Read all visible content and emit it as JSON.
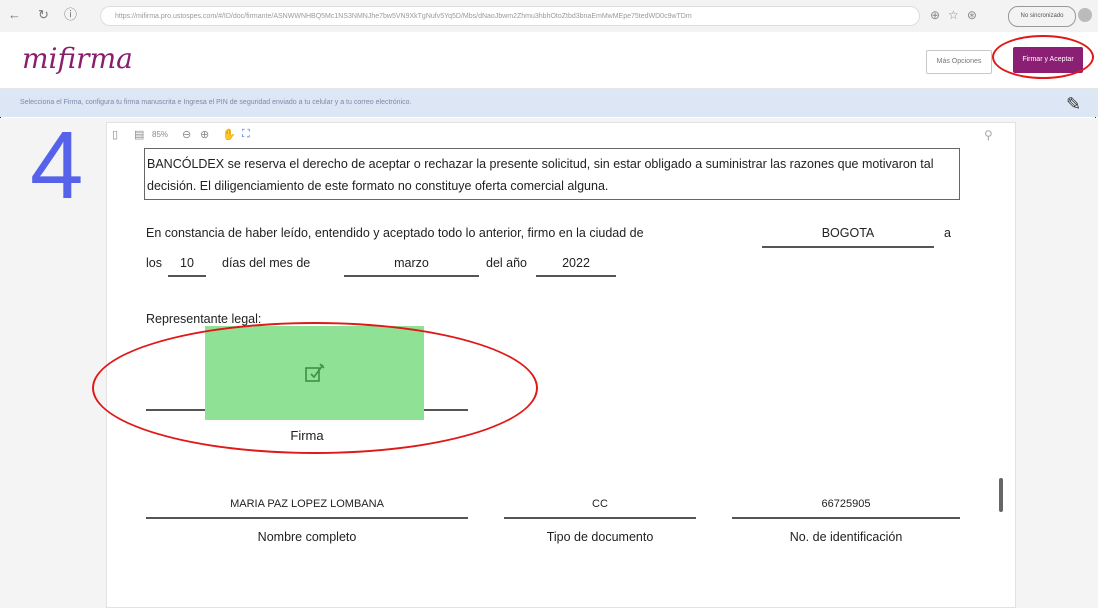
{
  "browser": {
    "url": "https://mifirma.pro.ustospes.com/#/ID/doc/firmante/ASNWWNHBQ5Mc1NS3NMNJhe7bw5VN9XkTgNufv5Yq5D/Mbs/dNaoJbwm2Zhmu3hbhOtoZtbd3bnaEmMwMEpe75tedWD0c9wTDm",
    "profile_label": "No sincronizado"
  },
  "header": {
    "logo": "mifirma",
    "secondary_button": "Más Opciones",
    "primary_button": "Firmar y Aceptar"
  },
  "info_bar": {
    "text": "Selecciona el Firma, configura tu firma manuscrita e Ingresa el PIN de seguridad enviado a tu celular y a tu correo electrónico."
  },
  "viewer": {
    "zoom": "85%"
  },
  "step_number": "4",
  "document": {
    "notice": "BANCÓLDEX se reserva el derecho de aceptar o rechazar la presente solicitud, sin estar obligado a suministrar las razones que motivaron tal decisión. El diligenciamiento de este formato no constituye oferta comercial alguna.",
    "constancia_text": "En constancia de haber leído, entendido y aceptado todo lo anterior, firmo en la ciudad de",
    "city": "BOGOTA",
    "a_word": "a",
    "los_word": "los",
    "day": "10",
    "dias_text": "días del mes de",
    "month": "marzo",
    "del_anio_text": "del año",
    "year": "2022",
    "rep_legal_label": "Representante legal:",
    "firma_label": "Firma",
    "full_name": "MARIA PAZ LOPEZ LOMBANA",
    "full_name_label": "Nombre completo",
    "doc_type": "CC",
    "doc_type_label": "Tipo de documento",
    "id_number": "66725905",
    "id_number_label": "No. de identificación"
  },
  "colors": {
    "brand": "#8b1f73",
    "signature_box": "#8fe295",
    "highlight_ellipse": "#e01818",
    "step_number": "#5662ea"
  }
}
